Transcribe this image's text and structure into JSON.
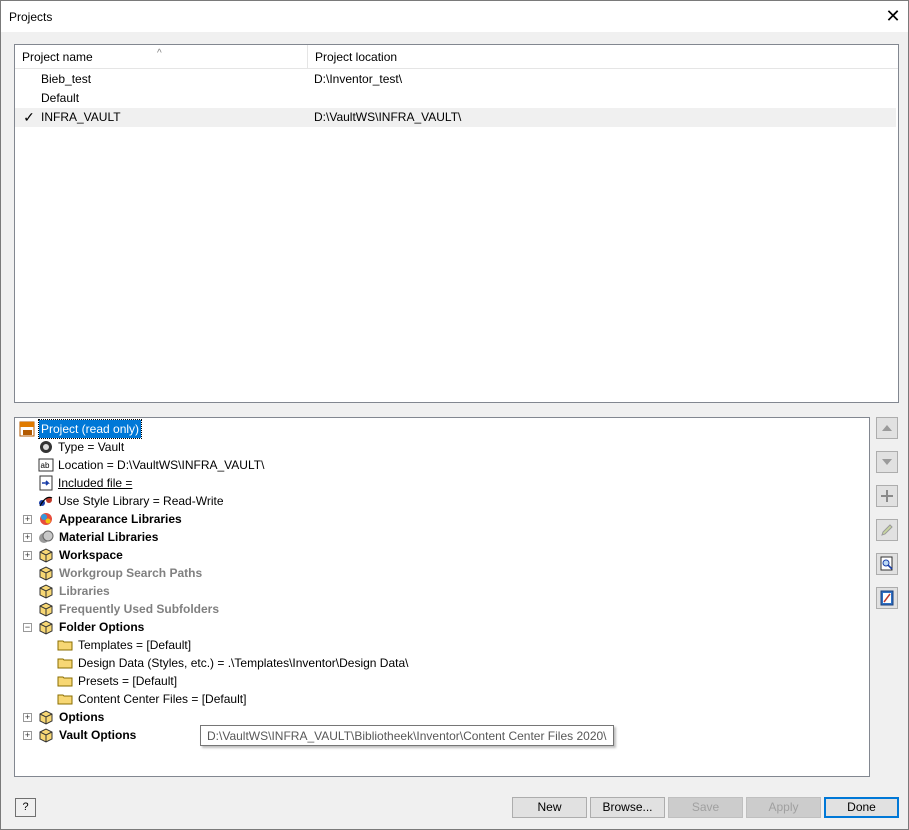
{
  "window": {
    "title": "Projects",
    "close_glyph": "✕"
  },
  "project_list": {
    "columns": [
      "Project name",
      "Project location"
    ],
    "sort_indicator": "^",
    "rows": [
      {
        "name": "Bieb_test",
        "location": "D:\\Inventor_test\\",
        "active": false
      },
      {
        "name": "Default",
        "location": "",
        "active": false
      },
      {
        "name": "INFRA_VAULT",
        "location": "D:\\VaultWS\\INFRA_VAULT\\",
        "active": true,
        "check": "✓"
      }
    ]
  },
  "tree": {
    "root": "Project (read only)",
    "type": "Type = Vault",
    "location": "Location = D:\\VaultWS\\INFRA_VAULT\\",
    "included_file": "Included file = ",
    "style_library": "Use Style Library = Read-Write",
    "appearance_libraries": "Appearance Libraries",
    "material_libraries": "Material Libraries",
    "workspace": "Workspace",
    "workgroup_search_paths": "Workgroup Search Paths",
    "libraries": "Libraries",
    "frequently_used_subfolders": "Frequently Used Subfolders",
    "folder_options": "Folder Options",
    "templates": "Templates = [Default]",
    "design_data": "Design Data (Styles, etc.) = .\\Templates\\Inventor\\Design Data\\",
    "presets": "Presets = [Default]",
    "content_center_files": "Content Center Files = [Default]",
    "options": "Options",
    "vault_options": "Vault Options",
    "expand_plus": "+",
    "expand_minus": "−"
  },
  "tooltip": "D:\\VaultWS\\INFRA_VAULT\\Bibliotheek\\Inventor\\Content Center Files 2020\\",
  "buttons": {
    "help": "?",
    "new": "New",
    "browse": "Browse...",
    "save": "Save",
    "apply": "Apply",
    "done": "Done"
  },
  "colors": {
    "selection": "#0078d7",
    "folder": "#f7d774"
  }
}
